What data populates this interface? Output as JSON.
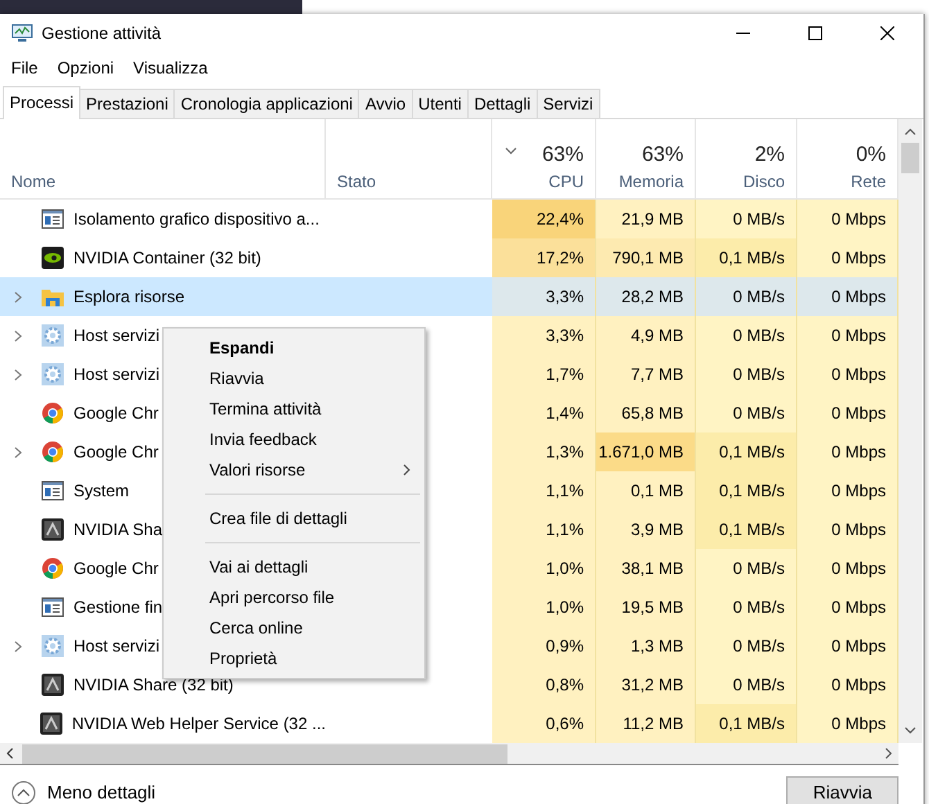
{
  "window": {
    "title": "Gestione attività"
  },
  "menu_bar": [
    "File",
    "Opzioni",
    "Visualizza"
  ],
  "tabs": [
    {
      "label": "Processi",
      "selected": true
    },
    {
      "label": "Prestazioni",
      "selected": false
    },
    {
      "label": "Cronologia applicazioni",
      "selected": false
    },
    {
      "label": "Avvio",
      "selected": false
    },
    {
      "label": "Utenti",
      "selected": false
    },
    {
      "label": "Dettagli",
      "selected": false
    },
    {
      "label": "Servizi",
      "selected": false
    }
  ],
  "table": {
    "columns": [
      {
        "label": "Nome",
        "sorted": false
      },
      {
        "label": "Stato",
        "sorted": false
      },
      {
        "label": "CPU",
        "total": "63%",
        "sorted": true
      },
      {
        "label": "Memoria",
        "total": "63%",
        "sorted": false
      },
      {
        "label": "Disco",
        "total": "2%",
        "sorted": false
      },
      {
        "label": "Rete",
        "total": "0%",
        "sorted": false
      }
    ],
    "rows": [
      {
        "kind": "window",
        "expandable": false,
        "selected": false,
        "cells": [
          {
            "text": "Isolamento grafico dispositivo a..."
          },
          {
            "text": ""
          },
          {
            "text": "22,4%",
            "color": "#f9d47a"
          },
          {
            "text": "21,9 MB",
            "color": "#fff1c0"
          },
          {
            "text": "0 MB/s",
            "color": "#fff4c4"
          },
          {
            "text": "0 Mbps",
            "color": "#fff4c4"
          }
        ]
      },
      {
        "kind": "nvidia",
        "expandable": false,
        "selected": false,
        "cells": [
          {
            "text": "NVIDIA Container (32 bit)"
          },
          {
            "text": ""
          },
          {
            "text": "17,2%",
            "color": "#fbe09a"
          },
          {
            "text": "790,1 MB",
            "color": "#fdeab0"
          },
          {
            "text": "0,1 MB/s",
            "color": "#fcecaa"
          },
          {
            "text": "0 Mbps",
            "color": "#fff4c4"
          }
        ]
      },
      {
        "kind": "folder",
        "expandable": true,
        "selected": true,
        "cells": [
          {
            "text": "Esplora risorse"
          },
          {
            "text": ""
          },
          {
            "text": "3,3%",
            "color": "#dde8ec"
          },
          {
            "text": "28,2 MB",
            "color": "#dde8ec"
          },
          {
            "text": "0 MB/s",
            "color": "#dde8ec"
          },
          {
            "text": "0 Mbps",
            "color": "#dde8ec"
          }
        ]
      },
      {
        "kind": "gear",
        "expandable": true,
        "selected": false,
        "cells": [
          {
            "text": "Host servizi"
          },
          {
            "text": ""
          },
          {
            "text": "3,3%",
            "color": "#fff1c0"
          },
          {
            "text": "4,9 MB",
            "color": "#fff1c0"
          },
          {
            "text": "0 MB/s",
            "color": "#fff4c4"
          },
          {
            "text": "0 Mbps",
            "color": "#fff4c4"
          }
        ]
      },
      {
        "kind": "gear",
        "expandable": true,
        "selected": false,
        "cells": [
          {
            "text": "Host servizi"
          },
          {
            "text": ""
          },
          {
            "text": "1,7%",
            "color": "#fff1c0"
          },
          {
            "text": "7,7 MB",
            "color": "#fff1c0"
          },
          {
            "text": "0 MB/s",
            "color": "#fff4c4"
          },
          {
            "text": "0 Mbps",
            "color": "#fff4c4"
          }
        ]
      },
      {
        "kind": "chrome",
        "expandable": false,
        "selected": false,
        "cells": [
          {
            "text": "Google Chr"
          },
          {
            "text": ""
          },
          {
            "text": "1,4%",
            "color": "#fff1c0"
          },
          {
            "text": "65,8 MB",
            "color": "#fff1c0"
          },
          {
            "text": "0 MB/s",
            "color": "#fff4c4"
          },
          {
            "text": "0 Mbps",
            "color": "#fff4c4"
          }
        ]
      },
      {
        "kind": "chrome",
        "expandable": true,
        "selected": false,
        "cells": [
          {
            "text": "Google Chr"
          },
          {
            "text": ""
          },
          {
            "text": "1,3%",
            "color": "#fff1c0"
          },
          {
            "text": "1.671,0 MB",
            "color": "#fbdb88"
          },
          {
            "text": "0,1 MB/s",
            "color": "#fcecaa"
          },
          {
            "text": "0 Mbps",
            "color": "#fff4c4"
          }
        ]
      },
      {
        "kind": "window",
        "expandable": false,
        "selected": false,
        "cells": [
          {
            "text": "System"
          },
          {
            "text": ""
          },
          {
            "text": "1,1%",
            "color": "#fff1c0"
          },
          {
            "text": "0,1 MB",
            "color": "#fff1c0"
          },
          {
            "text": "0,1 MB/s",
            "color": "#fcecaa"
          },
          {
            "text": "0 Mbps",
            "color": "#fff4c4"
          }
        ]
      },
      {
        "kind": "share",
        "expandable": false,
        "selected": false,
        "cells": [
          {
            "text": "NVIDIA Sha"
          },
          {
            "text": ""
          },
          {
            "text": "1,1%",
            "color": "#fff1c0"
          },
          {
            "text": "3,9 MB",
            "color": "#fff1c0"
          },
          {
            "text": "0,1 MB/s",
            "color": "#fcecaa"
          },
          {
            "text": "0 Mbps",
            "color": "#fff4c4"
          }
        ]
      },
      {
        "kind": "chrome",
        "expandable": false,
        "selected": false,
        "cells": [
          {
            "text": "Google Chr"
          },
          {
            "text": ""
          },
          {
            "text": "1,0%",
            "color": "#fff1c0"
          },
          {
            "text": "38,1 MB",
            "color": "#fff1c0"
          },
          {
            "text": "0 MB/s",
            "color": "#fff4c4"
          },
          {
            "text": "0 Mbps",
            "color": "#fff4c4"
          }
        ]
      },
      {
        "kind": "window",
        "expandable": false,
        "selected": false,
        "cells": [
          {
            "text": "Gestione fin"
          },
          {
            "text": ""
          },
          {
            "text": "1,0%",
            "color": "#fff1c0"
          },
          {
            "text": "19,5 MB",
            "color": "#fff1c0"
          },
          {
            "text": "0 MB/s",
            "color": "#fff4c4"
          },
          {
            "text": "0 Mbps",
            "color": "#fff4c4"
          }
        ]
      },
      {
        "kind": "gear",
        "expandable": true,
        "selected": false,
        "cells": [
          {
            "text": "Host servizi"
          },
          {
            "text": ""
          },
          {
            "text": "0,9%",
            "color": "#fff1c0"
          },
          {
            "text": "1,3 MB",
            "color": "#fff1c0"
          },
          {
            "text": "0 MB/s",
            "color": "#fff4c4"
          },
          {
            "text": "0 Mbps",
            "color": "#fff4c4"
          }
        ]
      },
      {
        "kind": "share",
        "expandable": false,
        "selected": false,
        "cells": [
          {
            "text": "NVIDIA Share (32 bit)"
          },
          {
            "text": ""
          },
          {
            "text": "0,8%",
            "color": "#fff1c0"
          },
          {
            "text": "31,2 MB",
            "color": "#fff1c0"
          },
          {
            "text": "0 MB/s",
            "color": "#fff4c4"
          },
          {
            "text": "0 Mbps",
            "color": "#fff4c4"
          }
        ]
      },
      {
        "kind": "share",
        "expandable": false,
        "selected": false,
        "cells": [
          {
            "text": "NVIDIA Web Helper Service (32 ..."
          },
          {
            "text": ""
          },
          {
            "text": "0,6%",
            "color": "#fff1c0"
          },
          {
            "text": "11,2 MB",
            "color": "#fff1c0"
          },
          {
            "text": "0,1 MB/s",
            "color": "#fcecaa"
          },
          {
            "text": "0 Mbps",
            "color": "#fff4c4"
          }
        ]
      }
    ]
  },
  "context_menu": [
    {
      "kind": "item",
      "label": "Espandi",
      "bold": true,
      "submenu": false
    },
    {
      "kind": "item",
      "label": "Riavvia",
      "bold": false,
      "submenu": false
    },
    {
      "kind": "item",
      "label": "Termina attività",
      "bold": false,
      "submenu": false
    },
    {
      "kind": "item",
      "label": "Invia feedback",
      "bold": false,
      "submenu": false
    },
    {
      "kind": "item",
      "label": "Valori risorse",
      "bold": false,
      "submenu": true
    },
    {
      "kind": "separator"
    },
    {
      "kind": "item",
      "label": "Crea file di dettagli",
      "bold": false,
      "submenu": false
    },
    {
      "kind": "separator"
    },
    {
      "kind": "item",
      "label": "Vai ai dettagli",
      "bold": false,
      "submenu": false
    },
    {
      "kind": "item",
      "label": "Apri percorso file",
      "bold": false,
      "submenu": false
    },
    {
      "kind": "item",
      "label": "Cerca online",
      "bold": false,
      "submenu": false
    },
    {
      "kind": "item",
      "label": "Proprietà",
      "bold": false,
      "submenu": false
    }
  ],
  "footer": {
    "details_toggle": "Meno dettagli",
    "button": "Riavvia"
  }
}
